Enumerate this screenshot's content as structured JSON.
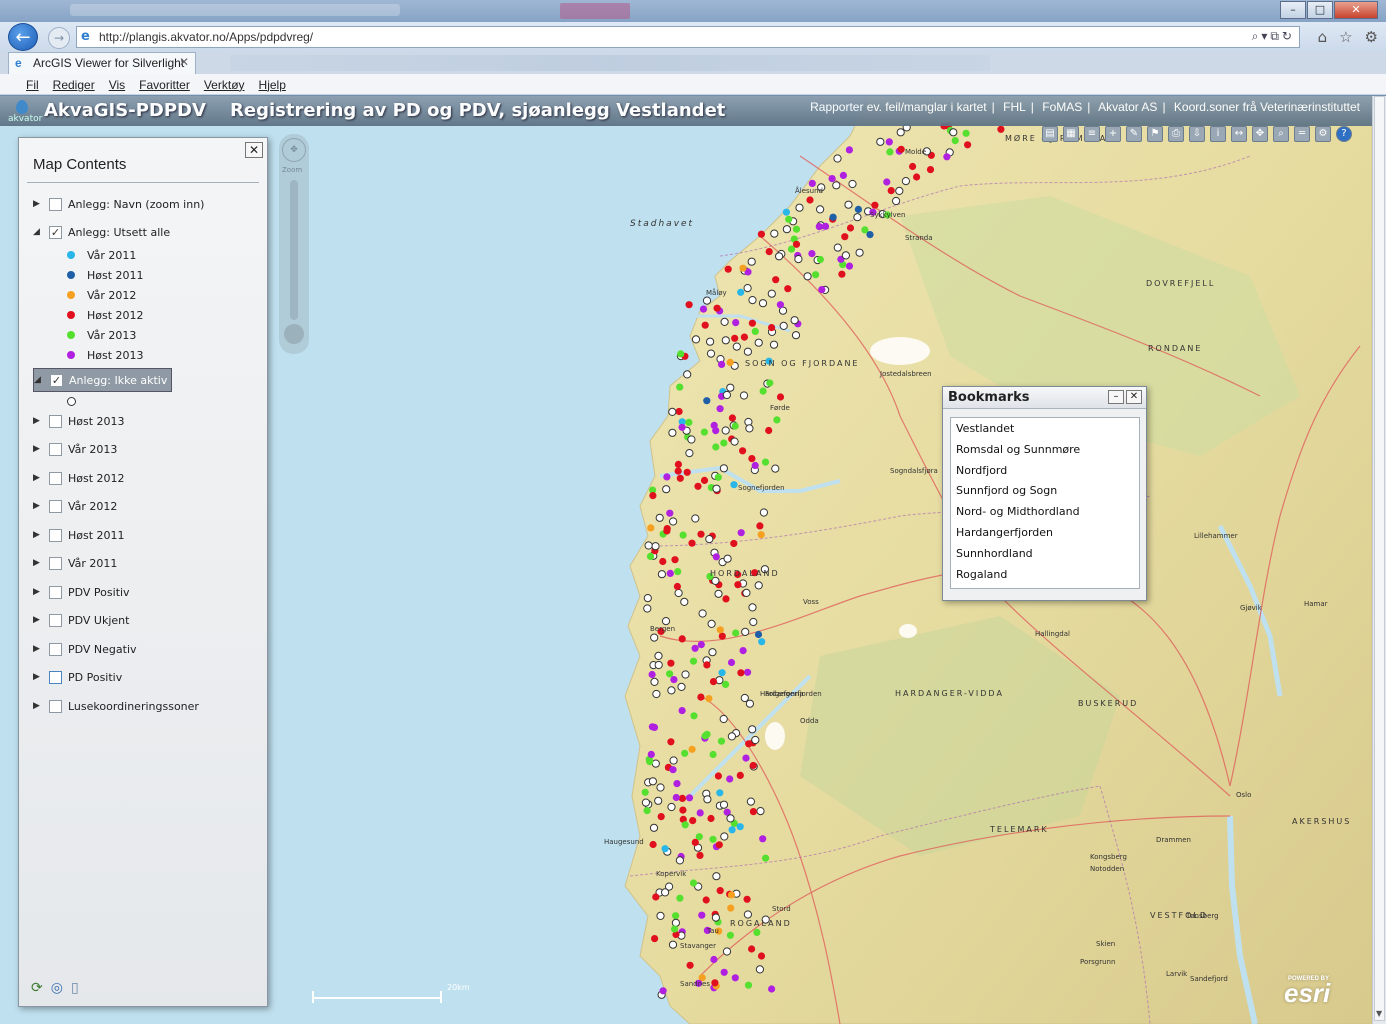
{
  "browser": {
    "url": "http://plangis.akvator.no/Apps/pdpdvreg/",
    "tab_title": "ArcGIS Viewer for Silverlight",
    "menu": [
      "Fil",
      "Rediger",
      "Vis",
      "Favoritter",
      "Verktøy",
      "Hjelp"
    ]
  },
  "app": {
    "title": "AkvaGIS-PDPDV",
    "subtitle": "Registrering av PD og PDV, sjøanlegg Vestlandet",
    "logo_text": "akvator",
    "links": [
      "Rapporter ev. feil/manglar i kartet",
      "FHL",
      "FoMAS",
      "Akvator AS",
      "Koord.soner frå Veterinærinstituttet"
    ]
  },
  "map_contents": {
    "title": "Map Contents",
    "layers": [
      {
        "label": "Anlegg: Navn (zoom inn)",
        "expanded": false,
        "checked": false
      },
      {
        "label": "Anlegg: Utsett alle",
        "expanded": true,
        "checked": true
      },
      {
        "label": "Anlegg: Ikke aktiv",
        "expanded": true,
        "checked": true,
        "selected": true
      },
      {
        "label": "Høst 2013",
        "expanded": false,
        "checked": false
      },
      {
        "label": "Vår 2013",
        "expanded": false,
        "checked": false
      },
      {
        "label": "Høst 2012",
        "expanded": false,
        "checked": false
      },
      {
        "label": "Vår 2012",
        "expanded": false,
        "checked": false
      },
      {
        "label": "Høst 2011",
        "expanded": false,
        "checked": false
      },
      {
        "label": "Vår 2011",
        "expanded": false,
        "checked": false
      },
      {
        "label": "PDV Positiv",
        "expanded": false,
        "checked": false
      },
      {
        "label": "PDV Ukjent",
        "expanded": false,
        "checked": false
      },
      {
        "label": "PDV Negativ",
        "expanded": false,
        "checked": false
      },
      {
        "label": "PD Positiv",
        "expanded": false,
        "checked": false
      },
      {
        "label": "Lusekoordineringssoner",
        "expanded": false,
        "checked": false
      }
    ],
    "legend": [
      {
        "label": "Vår 2011",
        "color": "#29b6e8"
      },
      {
        "label": "Høst 2011",
        "color": "#1f5fa8"
      },
      {
        "label": "Vår 2012",
        "color": "#f5a020"
      },
      {
        "label": "Høst 2012",
        "color": "#e0101e"
      },
      {
        "label": "Vår 2013",
        "color": "#55e030"
      },
      {
        "label": "Høst 2013",
        "color": "#b020e0"
      }
    ]
  },
  "bookmarks": {
    "title": "Bookmarks",
    "items": [
      "Vestlandet",
      "Romsdal og Sunnmøre",
      "Nordfjord",
      "Sunnfjord og Sogn",
      "Nord- og Midthordland",
      "Hardangerfjorden",
      "Sunnhordland",
      "Rogaland"
    ]
  },
  "map": {
    "sea_labels": [
      "Stadhavet"
    ],
    "region_labels": [
      "SOGN OG FJORDANE",
      "HORDALAND",
      "ROGALAND",
      "BUSKERUD",
      "TELEMARK",
      "VESTFOLD",
      "AKERSHUS",
      "MØRE og ROMSDAL",
      "DOVREFJELL",
      "RONDANE",
      "HARDANGER-VIDDA"
    ],
    "place_labels": [
      "Ålesund",
      "Molde",
      "Sykkylven",
      "Stranda",
      "Måløy",
      "Førde",
      "Sogndalsfjøra",
      "Bergen",
      "Odda",
      "Haugesund",
      "Stavanger",
      "Sandnes",
      "Oslo",
      "Drammen",
      "Lillehammer",
      "Kongsberg",
      "Tønsberg",
      "Sandefjord",
      "Larvik",
      "Hamar",
      "Gjøvik",
      "Voss",
      "Stord",
      "Kopervik",
      "Tau",
      "Skien",
      "Porsgrunn",
      "Notodden",
      "Jostedalsbreen",
      "Hallingdal",
      "Sognefjorden",
      "Folgefonna",
      "Hardangerfjorden"
    ],
    "scale_label": "20km"
  },
  "footer": {
    "esri_powered": "POWERED BY",
    "esri": "esri"
  }
}
